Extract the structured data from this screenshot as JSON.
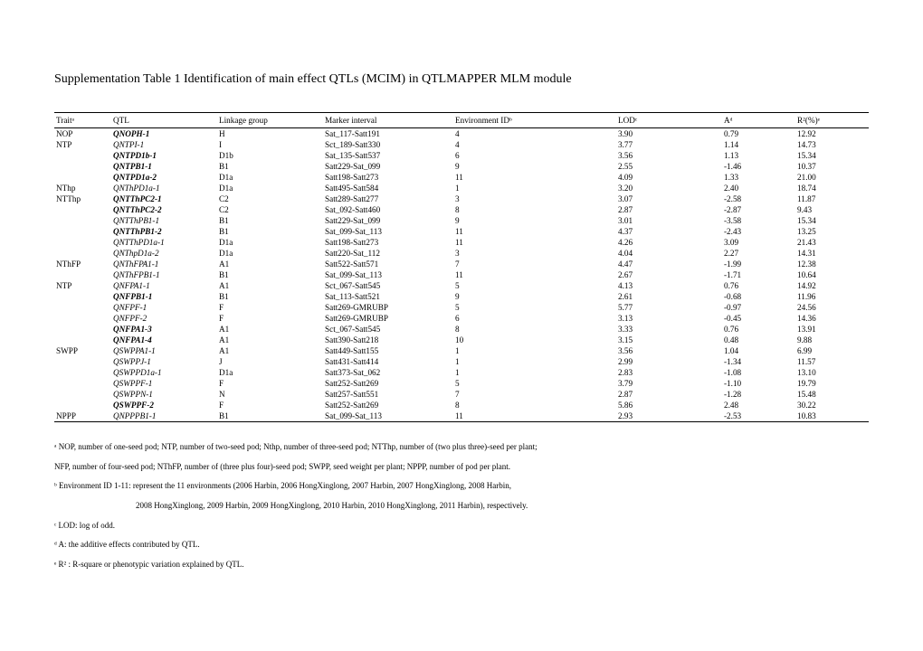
{
  "title": "Supplementation Table 1 Identification of main effect QTLs (MCIM) in QTLMAPPER MLM module",
  "headers": {
    "trait": "Traitᵃ",
    "qtl": "QTL",
    "linkage": "Linkage group",
    "marker": "Marker interval",
    "env": "Environment IDᵇ",
    "lod": "LODᶜ",
    "a": "Aᵈ",
    "r2": "R²(%)ᵉ"
  },
  "rows": [
    {
      "trait": "NOP",
      "qtl": "QNOPH-1",
      "bold": true,
      "italic": true,
      "lg": "H",
      "marker": "Sat_117-Satt191",
      "env": "4",
      "lod": "3.90",
      "a": "0.79",
      "r2": "12.92"
    },
    {
      "trait": "NTP",
      "qtl": "QNTPI-1",
      "bold": false,
      "italic": true,
      "lg": "I",
      "marker": "Sct_189-Satt330",
      "env": "4",
      "lod": "3.77",
      "a": "1.14",
      "r2": "14.73"
    },
    {
      "trait": "",
      "qtl": "QNTPD1b-1",
      "bold": true,
      "italic": true,
      "lg": "D1b",
      "marker": "Sat_135-Satt537",
      "env": "6",
      "lod": "3.56",
      "a": "1.13",
      "r2": "15.34"
    },
    {
      "trait": "",
      "qtl": "QNTPB1-1",
      "bold": true,
      "italic": true,
      "lg": "B1",
      "marker": "Satt229-Sat_099",
      "env": "9",
      "lod": "2.55",
      "a": "-1.46",
      "r2": "10.37"
    },
    {
      "trait": "",
      "qtl": "QNTPD1a-2",
      "bold": true,
      "italic": true,
      "lg": "D1a",
      "marker": "Satt198-Satt273",
      "env": "11",
      "lod": "4.09",
      "a": "1.33",
      "r2": "21.00"
    },
    {
      "trait": "NThp",
      "qtl": "QNThPD1a-1",
      "bold": false,
      "italic": true,
      "lg": "D1a",
      "marker": "Satt495-Satt584",
      "env": "1",
      "lod": "3.20",
      "a": "2.40",
      "r2": "18.74"
    },
    {
      "trait": "NTThp",
      "qtl": "QNTThPC2-1",
      "bold": true,
      "italic": true,
      "lg": "C2",
      "marker": "Satt289-Satt277",
      "env": "3",
      "lod": "3.07",
      "a": "-2.58",
      "r2": "11.87"
    },
    {
      "trait": "",
      "qtl": "QNTThPC2-2",
      "bold": true,
      "italic": true,
      "lg": "C2",
      "marker": "Sat_092-Satt460",
      "env": "8",
      "lod": "2.87",
      "a": "-2.87",
      "r2": "9.43"
    },
    {
      "trait": "",
      "qtl": "QNTThPB1-1",
      "bold": false,
      "italic": true,
      "lg": "B1",
      "marker": "Satt229-Sat_099",
      "env": "9",
      "lod": "3.01",
      "a": "-3.58",
      "r2": "15.34"
    },
    {
      "trait": "",
      "qtl": "QNTThPB1-2",
      "bold": true,
      "italic": true,
      "lg": "B1",
      "marker": "Sat_099-Sat_113",
      "env": "11",
      "lod": "4.37",
      "a": "-2.43",
      "r2": "13.25"
    },
    {
      "trait": "",
      "qtl": "QNTThPD1a-1",
      "bold": false,
      "italic": true,
      "lg": "D1a",
      "marker": "Satt198-Satt273",
      "env": "11",
      "lod": "4.26",
      "a": "3.09",
      "r2": "21.43"
    },
    {
      "trait": "",
      "qtl": "QNThpD1a-2",
      "bold": false,
      "italic": true,
      "lg": "D1a",
      "marker": "Satt220-Sat_112",
      "env": "3",
      "lod": "4.04",
      "a": "2.27",
      "r2": "14.31"
    },
    {
      "trait": "NThFP",
      "qtl": "QNThFPA1-1",
      "bold": false,
      "italic": true,
      "lg": "A1",
      "marker": "Satt522-Satt571",
      "env": "7",
      "lod": "4.47",
      "a": "-1.99",
      "r2": "12.38"
    },
    {
      "trait": "",
      "qtl": "QNThFPB1-1",
      "bold": false,
      "italic": true,
      "lg": "B1",
      "marker": "Sat_099-Sat_113",
      "env": "11",
      "lod": "2.67",
      "a": "-1.71",
      "r2": "10.64"
    },
    {
      "trait": "NTP",
      "qtl": "QNFPA1-1",
      "bold": false,
      "italic": true,
      "lg": "A1",
      "marker": "Sct_067-Satt545",
      "env": "5",
      "lod": "4.13",
      "a": "0.76",
      "r2": "14.92"
    },
    {
      "trait": "",
      "qtl": "QNFPB1-1",
      "bold": true,
      "italic": true,
      "lg": "B1",
      "marker": "Sat_113-Satt521",
      "env": "9",
      "lod": "2.61",
      "a": "-0.68",
      "r2": "11.96"
    },
    {
      "trait": "",
      "qtl": "QNFPF-1",
      "bold": false,
      "italic": true,
      "lg": "F",
      "marker": "Satt269-GMRUBP",
      "env": "5",
      "lod": "5.77",
      "a": "-0.97",
      "r2": "24.56"
    },
    {
      "trait": "",
      "qtl": "QNFPF-2",
      "bold": false,
      "italic": true,
      "lg": "F",
      "marker": "Satt269-GMRUBP",
      "env": "6",
      "lod": "3.13",
      "a": "-0.45",
      "r2": "14.36"
    },
    {
      "trait": "",
      "qtl": "QNFPA1-3",
      "bold": true,
      "italic": true,
      "lg": "A1",
      "marker": "Sct_067-Satt545",
      "env": "8",
      "lod": "3.33",
      "a": "0.76",
      "r2": "13.91"
    },
    {
      "trait": "",
      "qtl": "QNFPA1-4",
      "bold": true,
      "italic": true,
      "lg": "A1",
      "marker": "Satt390-Satt218",
      "env": "10",
      "lod": "3.15",
      "a": "0.48",
      "r2": "9.88"
    },
    {
      "trait": "SWPP",
      "qtl": "QSWPPA1-1",
      "bold": false,
      "italic": true,
      "lg": "A1",
      "marker": "Satt449-Satt155",
      "env": "1",
      "lod": "3.56",
      "a": "1.04",
      "r2": "6.99"
    },
    {
      "trait": "",
      "qtl": "QSWPPJ-1",
      "bold": false,
      "italic": true,
      "lg": "J",
      "marker": "Satt431-Satt414",
      "env": "1",
      "lod": "2.99",
      "a": "-1.34",
      "r2": "11.57"
    },
    {
      "trait": "",
      "qtl": "QSWPPD1a-1",
      "bold": false,
      "italic": true,
      "lg": "D1a",
      "marker": "Satt373-Sat_062",
      "env": "1",
      "lod": "2.83",
      "a": "-1.08",
      "r2": "13.10"
    },
    {
      "trait": "",
      "qtl": "QSWPPF-1",
      "bold": false,
      "italic": true,
      "lg": "F",
      "marker": "Satt252-Satt269",
      "env": "5",
      "lod": "3.79",
      "a": "-1.10",
      "r2": "19.79"
    },
    {
      "trait": "",
      "qtl": "QSWPPN-1",
      "bold": false,
      "italic": true,
      "lg": "N",
      "marker": "Satt257-Satt551",
      "env": "7",
      "lod": "2.87",
      "a": "-1.28",
      "r2": "15.48"
    },
    {
      "trait": "",
      "qtl": "QSWPPF-2",
      "bold": true,
      "italic": true,
      "lg": "F",
      "marker": "Satt252-Satt269",
      "env": "8",
      "lod": "5.86",
      "a": "2.48",
      "r2": "30.22"
    },
    {
      "trait": "NPPP",
      "qtl": "QNPPPB1-1",
      "bold": false,
      "italic": true,
      "lg": "B1",
      "marker": "Sat_099-Sat_113",
      "env": "11",
      "lod": "2.93",
      "a": "-2.53",
      "r2": "10.83"
    }
  ],
  "footnotes": {
    "a1": "ᵃ NOP, number of one-seed pod; NTP, number of two-seed pod; Nthp, number of three-seed pod; NTThp, number of (two plus three)-seed per plant;",
    "a2": "NFP, number of four-seed pod; NThFP, number of (three plus four)-seed pod; SWPP, seed weight per plant; NPPP, number of pod per plant.",
    "b1": "ᵇ Environment ID 1-11: represent the 11 environments (2006 Harbin, 2006 HongXinglong, 2007 Harbin, 2007 HongXinglong, 2008 Harbin,",
    "b2": "2008 HongXinglong, 2009 Harbin, 2009 HongXinglong, 2010 Harbin, 2010 HongXinglong, 2011 Harbin), respectively.",
    "c": "ᶜ LOD: log of odd.",
    "d": "ᵈ A: the additive effects contributed by QTL.",
    "e": "ᵉ R² : R-square or phenotypic variation explained by QTL."
  }
}
